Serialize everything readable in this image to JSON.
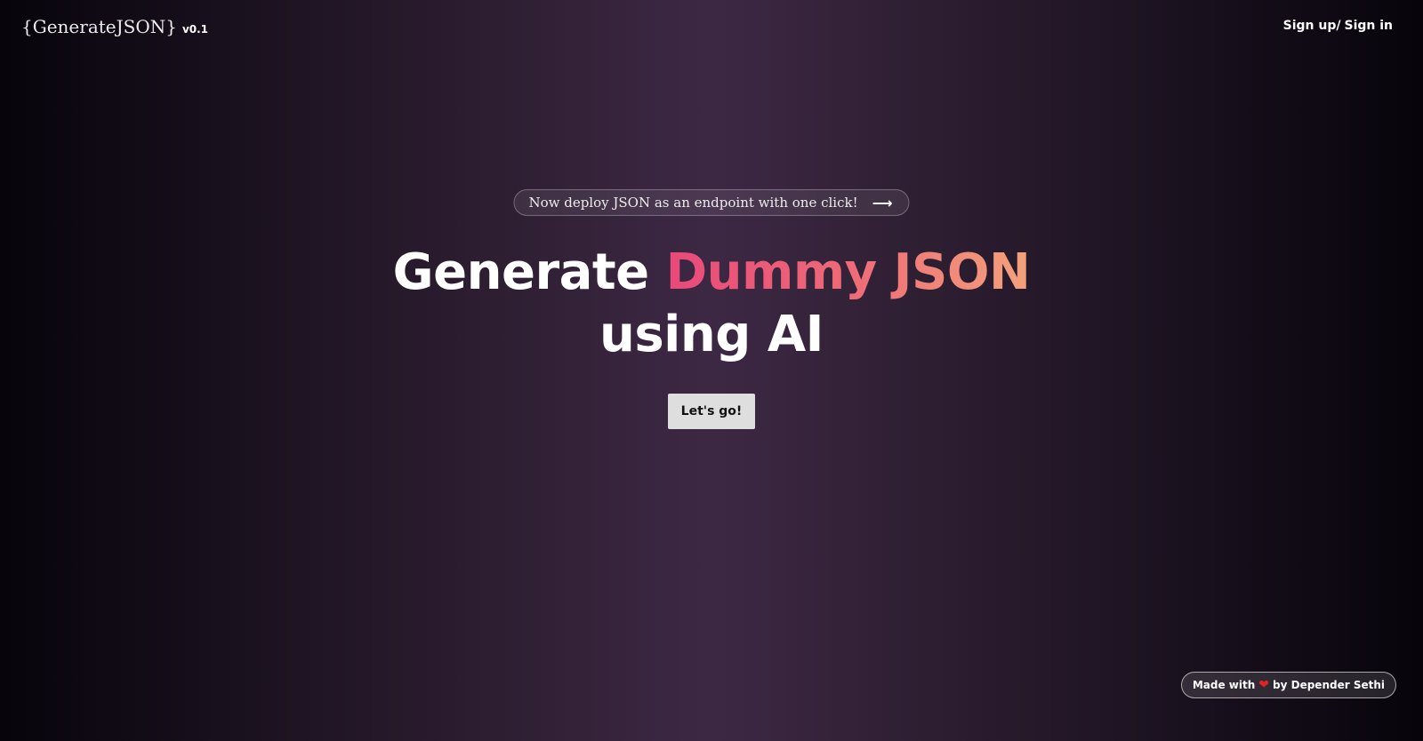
{
  "header": {
    "logo_text": "{GenerateJSON}",
    "version": "v0.1",
    "signup_label": "Sign up/",
    "signin_label": "Sign in"
  },
  "announcement": {
    "text": "Now deploy JSON as an endpoint with one click!",
    "icon": "arrow-right-icon",
    "arrow_glyph": "⟶"
  },
  "hero": {
    "title_line1_plain": "Generate",
    "title_line1_accent": "Dummy JSON",
    "title_line2": "using AI",
    "cta_label": "Let's go!"
  },
  "footer": {
    "credit_prefix": "Made with",
    "heart_glyph": "❤",
    "credit_suffix": "by Depender Sethi",
    "heart_icon": "heart-icon"
  },
  "colors": {
    "accent_start": "#e8497a",
    "accent_end": "#f2a27c",
    "cta_background": "#dedede",
    "heart": "#e02424"
  }
}
